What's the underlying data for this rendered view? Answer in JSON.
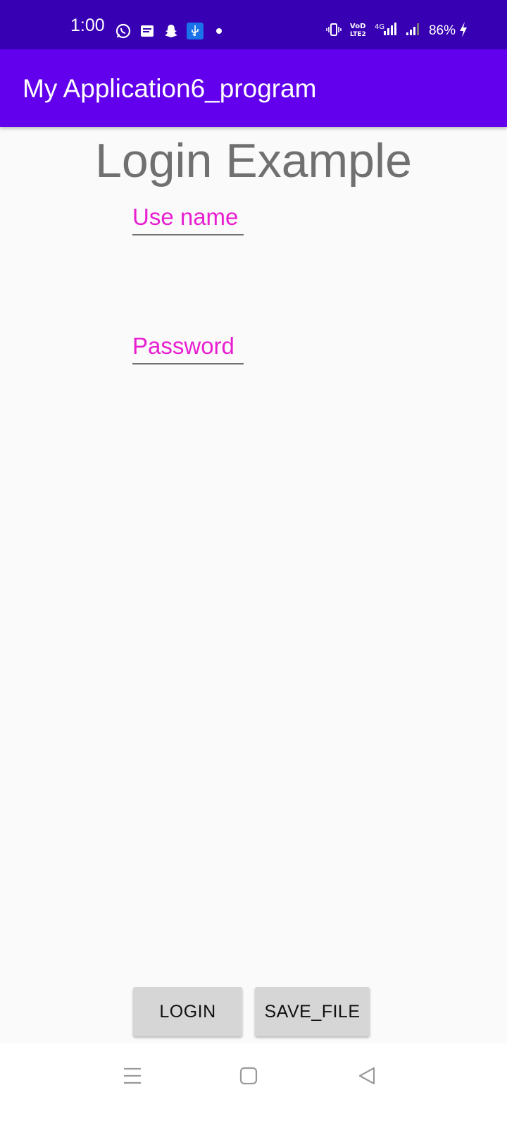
{
  "status_bar": {
    "time": "1:00",
    "battery": "86%",
    "icons_left": [
      "whatsapp-icon",
      "message-icon",
      "snapchat-icon",
      "usb-icon",
      "dot-icon"
    ],
    "icons_right": [
      "vibrate-icon",
      "volte-icon",
      "4g-signal-icon",
      "signal-icon",
      "charging-icon"
    ]
  },
  "app_bar": {
    "title": "My Application6_program"
  },
  "main": {
    "heading": "Login Example",
    "username_hint": "Use name",
    "password_hint": "Password",
    "login_button": "LOGIN",
    "save_button": "SAVE_FILE"
  },
  "nav_bar": {
    "icons": [
      "menu-icon",
      "home-icon",
      "back-icon"
    ]
  },
  "colors": {
    "status_bar": "#3700b3",
    "app_bar": "#6200ee",
    "hint_text": "#e81fd1",
    "background": "#fafafa",
    "button": "#d6d6d6"
  }
}
